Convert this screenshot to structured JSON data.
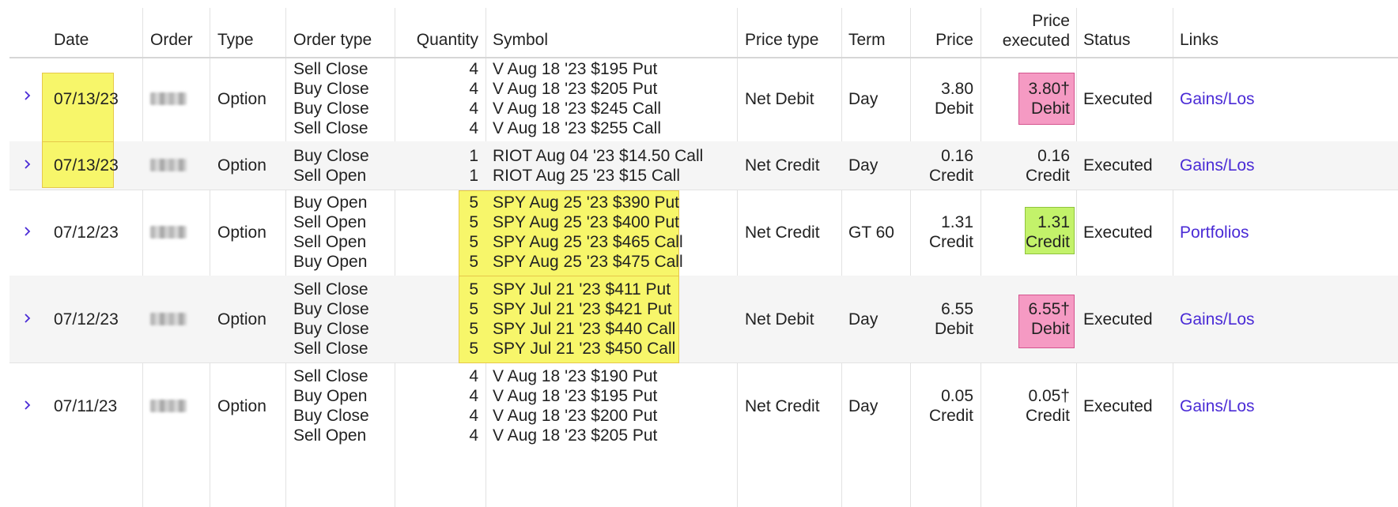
{
  "columns": {
    "date": "Date",
    "order": "Order",
    "type": "Type",
    "order_type": "Order type",
    "quantity": "Quantity",
    "symbol": "Symbol",
    "price_type": "Price type",
    "term": "Term",
    "price": "Price",
    "price_executed_line1": "Price",
    "price_executed_line2": "executed",
    "status": "Status",
    "links": "Links"
  },
  "rows": [
    {
      "date": "07/13/23",
      "type": "Option",
      "order_types": [
        "Sell Close",
        "Buy Close",
        "Buy Close",
        "Sell Close"
      ],
      "quantities": [
        "4",
        "4",
        "4",
        "4"
      ],
      "symbols": [
        "V Aug 18 '23 $195 Put",
        "V Aug 18 '23 $205 Put",
        "V Aug 18 '23 $245 Call",
        "V Aug 18 '23 $255 Call"
      ],
      "price_type": "Net Debit",
      "term": "Day",
      "price_value": "3.80",
      "price_side": "Debit",
      "executed_value": "3.80†",
      "executed_side": "Debit",
      "status": "Executed",
      "link": "Gains/Los"
    },
    {
      "date": "07/13/23",
      "type": "Option",
      "order_types": [
        "Buy Close",
        "Sell Open"
      ],
      "quantities": [
        "1",
        "1"
      ],
      "symbols": [
        "RIOT Aug 04 '23 $14.50 Call",
        "RIOT Aug 25 '23 $15 Call"
      ],
      "price_type": "Net Credit",
      "term": "Day",
      "price_value": "0.16",
      "price_side": "Credit",
      "executed_value": "0.16",
      "executed_side": "Credit",
      "status": "Executed",
      "link": "Gains/Los"
    },
    {
      "date": "07/12/23",
      "type": "Option",
      "order_types": [
        "Buy Open",
        "Sell Open",
        "Sell Open",
        "Buy Open"
      ],
      "quantities": [
        "5",
        "5",
        "5",
        "5"
      ],
      "symbols": [
        "SPY Aug 25 '23 $390 Put",
        "SPY Aug 25 '23 $400 Put",
        "SPY Aug 25 '23 $465 Call",
        "SPY Aug 25 '23 $475 Call"
      ],
      "price_type": "Net Credit",
      "term": "GT 60",
      "price_value": "1.31",
      "price_side": "Credit",
      "executed_value": "1.31",
      "executed_side": "Credit",
      "status": "Executed",
      "link": "Portfolios"
    },
    {
      "date": "07/12/23",
      "type": "Option",
      "order_types": [
        "Sell Close",
        "Buy Close",
        "Buy Close",
        "Sell Close"
      ],
      "quantities": [
        "5",
        "5",
        "5",
        "5"
      ],
      "symbols": [
        "SPY Jul 21 '23 $411 Put",
        "SPY Jul 21 '23 $421 Put",
        "SPY Jul 21 '23 $440 Call",
        "SPY Jul 21 '23 $450 Call"
      ],
      "price_type": "Net Debit",
      "term": "Day",
      "price_value": "6.55",
      "price_side": "Debit",
      "executed_value": "6.55†",
      "executed_side": "Debit",
      "status": "Executed",
      "link": "Gains/Los"
    },
    {
      "date": "07/11/23",
      "type": "Option",
      "order_types": [
        "Sell Close",
        "Buy Open",
        "Buy Close",
        "Sell Open"
      ],
      "quantities": [
        "4",
        "4",
        "4",
        "4"
      ],
      "symbols": [
        "V Aug 18 '23 $190 Put",
        "V Aug 18 '23 $195 Put",
        "V Aug 18 '23 $200 Put",
        "V Aug 18 '23 $205 Put"
      ],
      "price_type": "Net Credit",
      "term": "Day",
      "price_value": "0.05",
      "price_side": "Credit",
      "executed_value": "0.05†",
      "executed_side": "Credit",
      "status": "Executed",
      "link": "Gains/Los"
    }
  ],
  "colors": {
    "link": "#4a2bd6",
    "highlight_yellow": "#f7f66a",
    "highlight_pink": "#f59ac3",
    "highlight_green": "#c3f26a"
  },
  "icons": {
    "expand": "chevron-right-icon"
  }
}
